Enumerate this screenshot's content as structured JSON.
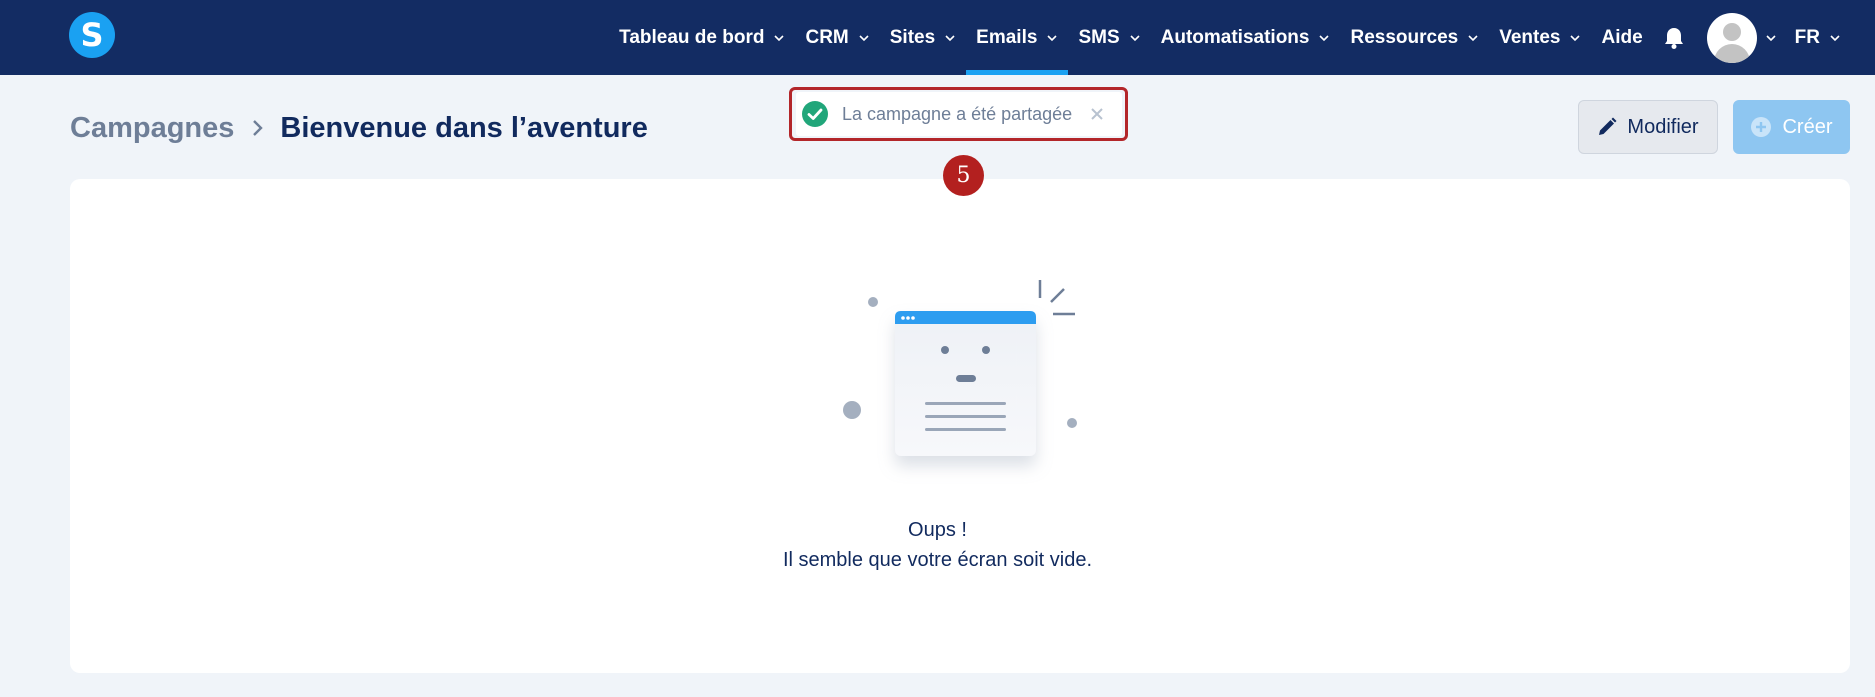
{
  "brand": {
    "logo_letter": "S",
    "accent": "#1aa1f2",
    "nav_bg": "#132c63"
  },
  "nav": {
    "items": [
      {
        "label": "Tableau de bord",
        "dropdown": true,
        "active": false
      },
      {
        "label": "CRM",
        "dropdown": true,
        "active": false
      },
      {
        "label": "Sites",
        "dropdown": true,
        "active": false
      },
      {
        "label": "Emails",
        "dropdown": true,
        "active": true
      },
      {
        "label": "SMS",
        "dropdown": true,
        "active": false
      },
      {
        "label": "Automatisations",
        "dropdown": true,
        "active": false
      },
      {
        "label": "Ressources",
        "dropdown": true,
        "active": false
      },
      {
        "label": "Ventes",
        "dropdown": true,
        "active": false
      },
      {
        "label": "Aide",
        "dropdown": false,
        "active": false
      }
    ],
    "language": "FR"
  },
  "breadcrumb": {
    "parent": "Campagnes",
    "current": "Bienvenue dans l’aventure"
  },
  "actions": {
    "modifier_label": "Modifier",
    "creer_label": "Créer"
  },
  "toast": {
    "message": "La campagne a été partagée",
    "success_color": "#21a67a"
  },
  "annotation": {
    "step_number": "5",
    "color": "#b3201f"
  },
  "empty_state": {
    "title": "Oups !",
    "subtitle": "Il semble que votre écran soit vide."
  }
}
